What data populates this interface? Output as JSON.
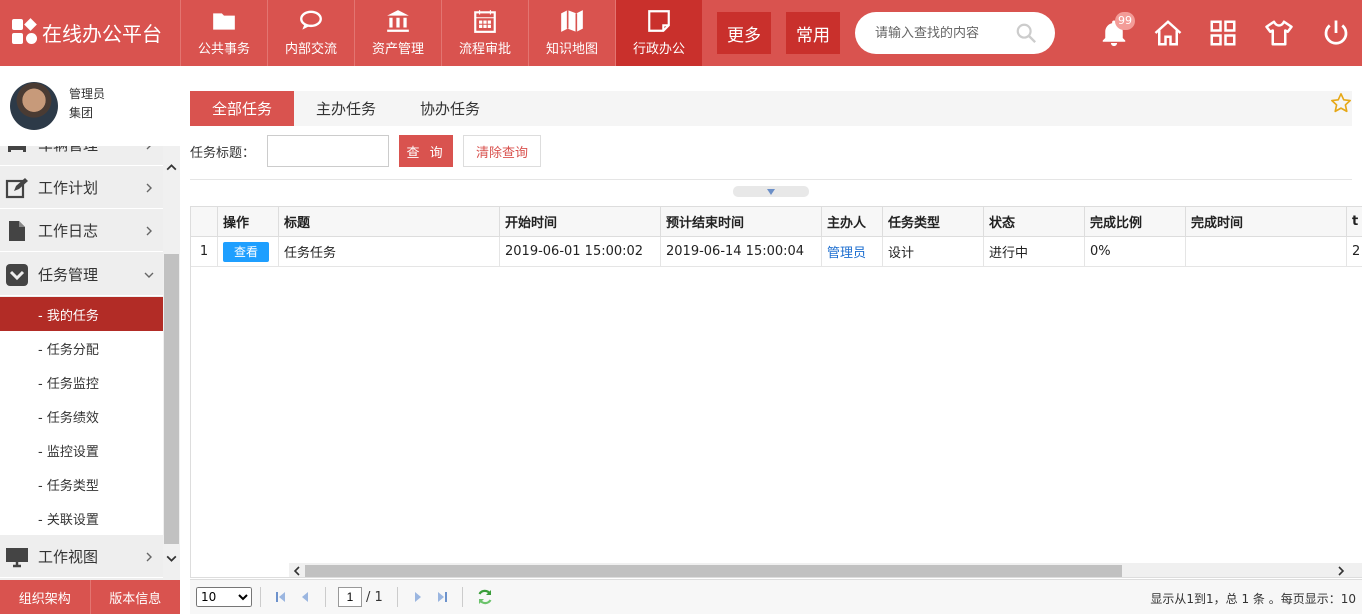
{
  "app": {
    "title": "在线办公平台"
  },
  "nav": [
    {
      "label": "公共事务",
      "icon": "folder-icon"
    },
    {
      "label": "内部交流",
      "icon": "chat-icon"
    },
    {
      "label": "资产管理",
      "icon": "bank-icon"
    },
    {
      "label": "流程审批",
      "icon": "calendar-icon"
    },
    {
      "label": "知识地图",
      "icon": "map-icon"
    },
    {
      "label": "行政办公",
      "icon": "note-icon"
    }
  ],
  "header": {
    "more_label": "更多",
    "common_label": "常用",
    "search_placeholder": "请输入查找的内容",
    "notification_count": "99"
  },
  "user": {
    "role": "管理员",
    "org": "集团"
  },
  "sidebar": {
    "partial_item": "车辆管理",
    "groups": [
      {
        "label": "工作计划",
        "icon": "edit-icon"
      },
      {
        "label": "工作日志",
        "icon": "document-icon"
      },
      {
        "label": "任务管理",
        "icon": "chevron-circle-icon"
      },
      {
        "label": "工作视图",
        "icon": "monitor-icon"
      }
    ],
    "sub_items": [
      "- 我的任务",
      "- 任务分配",
      "- 任务监控",
      "- 任务绩效",
      "- 监控设置",
      "- 任务类型",
      "- 关联设置"
    ],
    "footer": [
      "组织架构",
      "版本信息"
    ]
  },
  "tabs": [
    "全部任务",
    "主办任务",
    "协办任务"
  ],
  "filter": {
    "label": "任务标题：",
    "value": "",
    "query_label": "查 询",
    "clear_label": "清除查询"
  },
  "table": {
    "columns": [
      "",
      "操作",
      "标题",
      "开始时间",
      "预计结束时间",
      "主办人",
      "任务类型",
      "状态",
      "完成比例",
      "完成时间",
      "t"
    ],
    "rows": [
      {
        "num": "1",
        "action": "查看",
        "title": "任务任务",
        "start": "2019-06-01 15:00:02",
        "end": "2019-06-14 15:00:04",
        "owner": "管理员",
        "type": "设计",
        "status": "进行中",
        "ratio": "0%",
        "done": "",
        "extra": "2"
      }
    ]
  },
  "pager": {
    "page_size": "10",
    "page": "1",
    "total_pages": "/ 1",
    "info": "显示从1到1，总 1 条 。每页显示：10"
  },
  "colors": {
    "brand": "#d9534f",
    "brand_dark": "#c9302c",
    "active_sub": "#b22c26",
    "link": "#1e6fd0",
    "view_btn": "#1e9fff"
  }
}
